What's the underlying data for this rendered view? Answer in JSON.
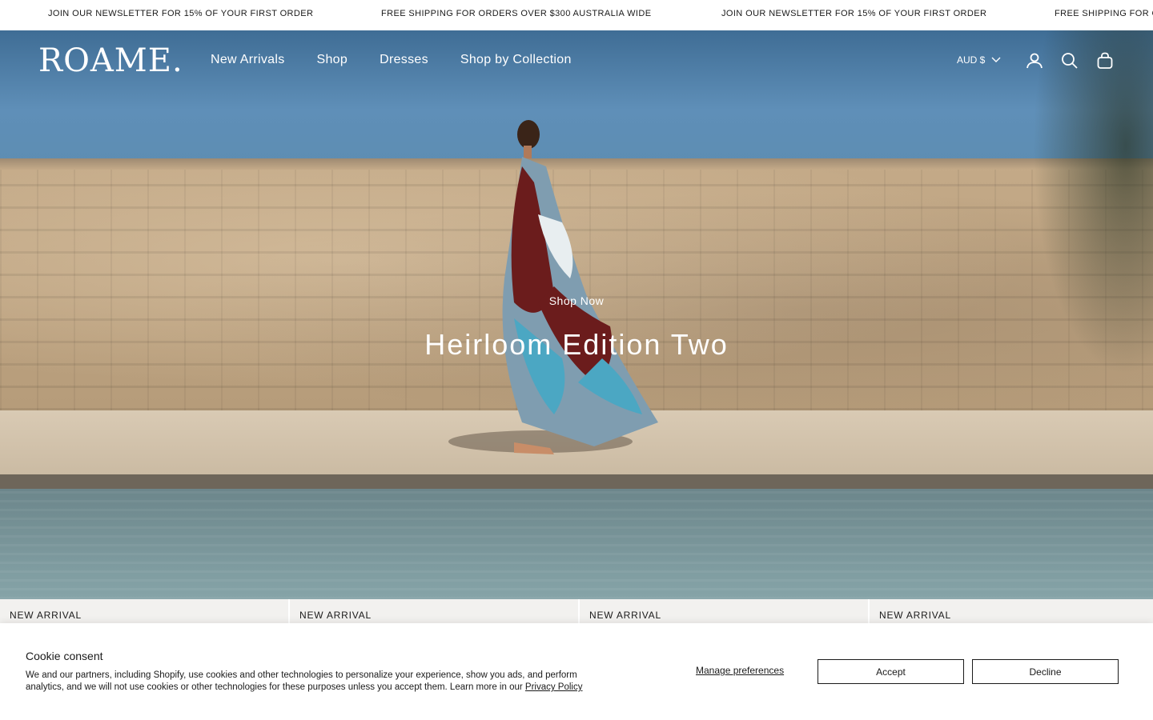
{
  "announcement": {
    "items": [
      "JOIN OUR NEWSLETTER FOR 15% OF YOUR FIRST ORDER",
      "FREE SHIPPING FOR ORDERS OVER $300 AUSTRALIA WIDE",
      "JOIN OUR NEWSLETTER FOR 15% OF YOUR FIRST ORDER",
      "FREE SHIPPING FOR OR"
    ]
  },
  "header": {
    "logo": "ROAME.",
    "nav": [
      "New Arrivals",
      "Shop",
      "Dresses",
      "Shop by Collection"
    ],
    "currency": "AUD $",
    "icons": [
      "account-icon",
      "search-icon",
      "bag-icon"
    ]
  },
  "hero": {
    "cta": "Shop Now",
    "title": "Heirloom Edition Two"
  },
  "products": {
    "badges": [
      "NEW ARRIVAL",
      "NEW ARRIVAL",
      "NEW ARRIVAL",
      "NEW ARRIVAL"
    ]
  },
  "cookie": {
    "title": "Cookie consent",
    "body": "We and our partners, including Shopify, use cookies and other technologies to personalize your experience, show you ads, and perform analytics, and we will not use cookies or other technologies for these purposes unless you accept them. Learn more in our ",
    "policy_link": "Privacy Policy",
    "manage": "Manage preferences",
    "accept": "Accept",
    "decline": "Decline"
  },
  "colors": {
    "text": "#1a1a1a",
    "header_text": "#ffffff",
    "sky": "#5f8fb8",
    "banner_bg": "#ffffff"
  }
}
